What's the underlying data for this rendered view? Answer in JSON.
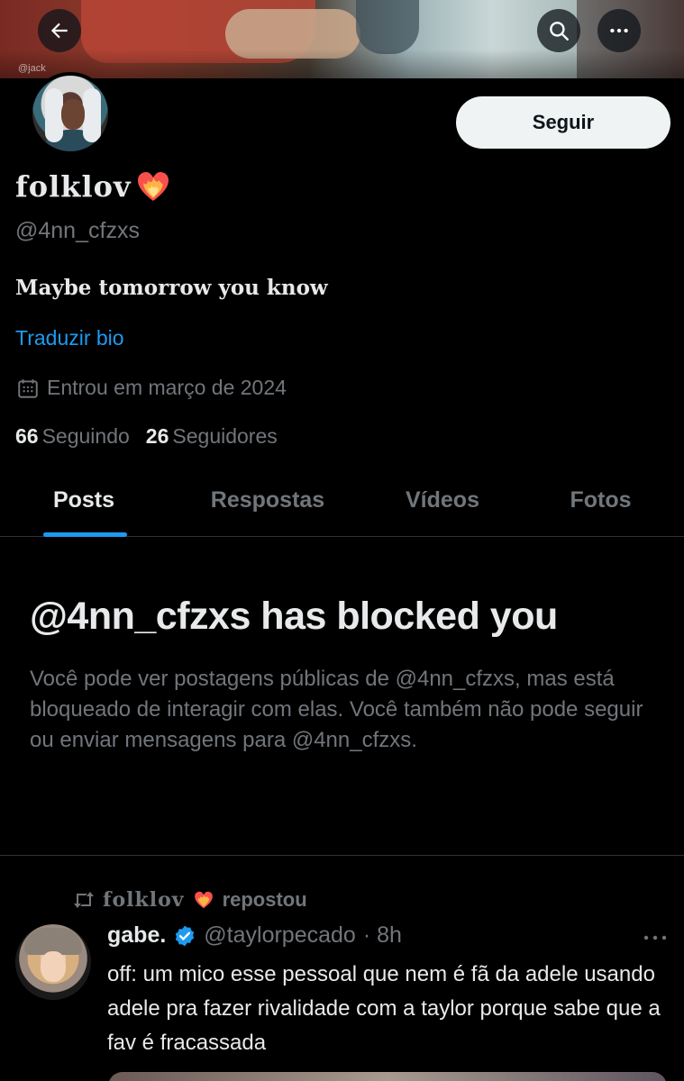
{
  "banner": {
    "watermark": "@jack"
  },
  "profile": {
    "display_name": "folklov",
    "handle": "@4nn_cfzxs",
    "bio": "Maybe tomorrow you know",
    "translate_label": "Traduzir bio",
    "joined": "Entrou em março de 2024",
    "following_count": "66",
    "following_label": "Seguindo",
    "followers_count": "26",
    "followers_label": "Seguidores",
    "follow_button": "Seguir"
  },
  "tabs": [
    {
      "label": "Posts",
      "active": true
    },
    {
      "label": "Respostas",
      "active": false
    },
    {
      "label": "Vídeos",
      "active": false
    },
    {
      "label": "Fotos",
      "active": false
    }
  ],
  "blocked": {
    "title": "@4nn_cfzxs has blocked you",
    "text": "Você pode ver postagens públicas de @4nn_cfzxs, mas está bloqueado de interagir com elas. Você também não pode seguir ou enviar mensagens para @4nn_cfzxs."
  },
  "tweet": {
    "repost_name": "folklov",
    "repost_label": "repostou",
    "author_name": "gabe.",
    "author_handle": "@taylorpecado",
    "time": "· 8h",
    "text": "off: um mico esse pessoal que nem é fã da adele usando adele pra fazer rivalidade com a taylor porque sabe que a fav é fracassada"
  },
  "colors": {
    "background": "#000000",
    "text_primary": "#e7e9ea",
    "text_secondary": "#71767b",
    "accent": "#1d9bf0",
    "follow_button_bg": "#eff3f4"
  },
  "icons": [
    "back-arrow-icon",
    "search-icon",
    "more-icon",
    "heart-on-fire-icon",
    "calendar-icon",
    "repost-icon",
    "verified-icon"
  ]
}
